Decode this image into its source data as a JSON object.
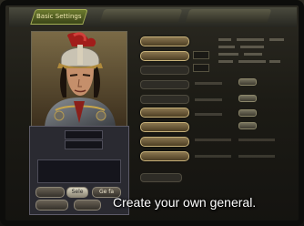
{
  "tabs": [
    {
      "label": "Basic Settings",
      "active": true
    },
    {
      "label": "",
      "active": false
    },
    {
      "label": "",
      "active": false
    }
  ],
  "info_panel": {
    "fields": [
      {
        "label": ""
      },
      {
        "label": ""
      },
      {
        "label": ""
      }
    ],
    "buttons": [
      {
        "label": ""
      },
      {
        "label": "Sele"
      },
      {
        "label": "Ge fa"
      },
      {
        "label": ""
      },
      {
        "label": ""
      }
    ]
  },
  "stats": {
    "rows": [
      {
        "value": ""
      },
      {
        "value": ""
      },
      {
        "value": ""
      },
      {
        "value": ""
      },
      {
        "value": ""
      },
      {
        "value": ""
      },
      {
        "value": ""
      },
      {
        "value": ""
      }
    ]
  },
  "caption": "Create your own general.",
  "colors": {
    "accent": "#c8b27a",
    "tab_active": "#6c7a2e",
    "caption": "#ffffff"
  }
}
